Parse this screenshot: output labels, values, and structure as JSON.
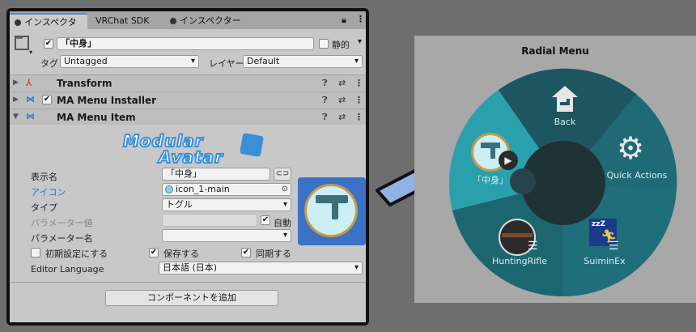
{
  "inspector": {
    "tabs": [
      "インスペクター",
      "VRChat SDK",
      "インスペクター"
    ],
    "object_name": "「中身」",
    "static_label": "静的",
    "tag_label": "タグ",
    "tag_value": "Untagged",
    "layer_label": "レイヤー",
    "layer_value": "Default",
    "components": [
      {
        "name": "Transform"
      },
      {
        "name": "MA Menu Installer"
      },
      {
        "name": "MA Menu Item"
      }
    ],
    "logo_line1": "Modular",
    "logo_line2": "Avatar",
    "fields": {
      "display_name_label": "表示名",
      "display_name_value": "「中身」",
      "icon_label": "アイコン",
      "icon_value": "icon_1-main",
      "type_label": "タイプ",
      "type_value": "トグル",
      "param_value_label": "パラメーター値",
      "auto_label": "自動",
      "param_name_label": "パラメーター名",
      "default_label": "初期設定にする",
      "save_label": "保存する",
      "sync_label": "同期する",
      "editor_language_label": "Editor Language",
      "editor_language_value": "日本語 (日本)",
      "add_component": "コンポーネントを追加"
    }
  },
  "radial": {
    "title": "Radial Menu",
    "items": {
      "back": "Back",
      "quick": "Quick Actions",
      "current": "「中身」",
      "hunting": "HuntingRifle",
      "suimin": "SuiminEx"
    }
  },
  "colors": {
    "accent_blue": "#2c6fd6",
    "radial_teal": "#1f6e78",
    "radial_dark": "#1e3238",
    "arrow_fill": "#8fb3e6"
  }
}
